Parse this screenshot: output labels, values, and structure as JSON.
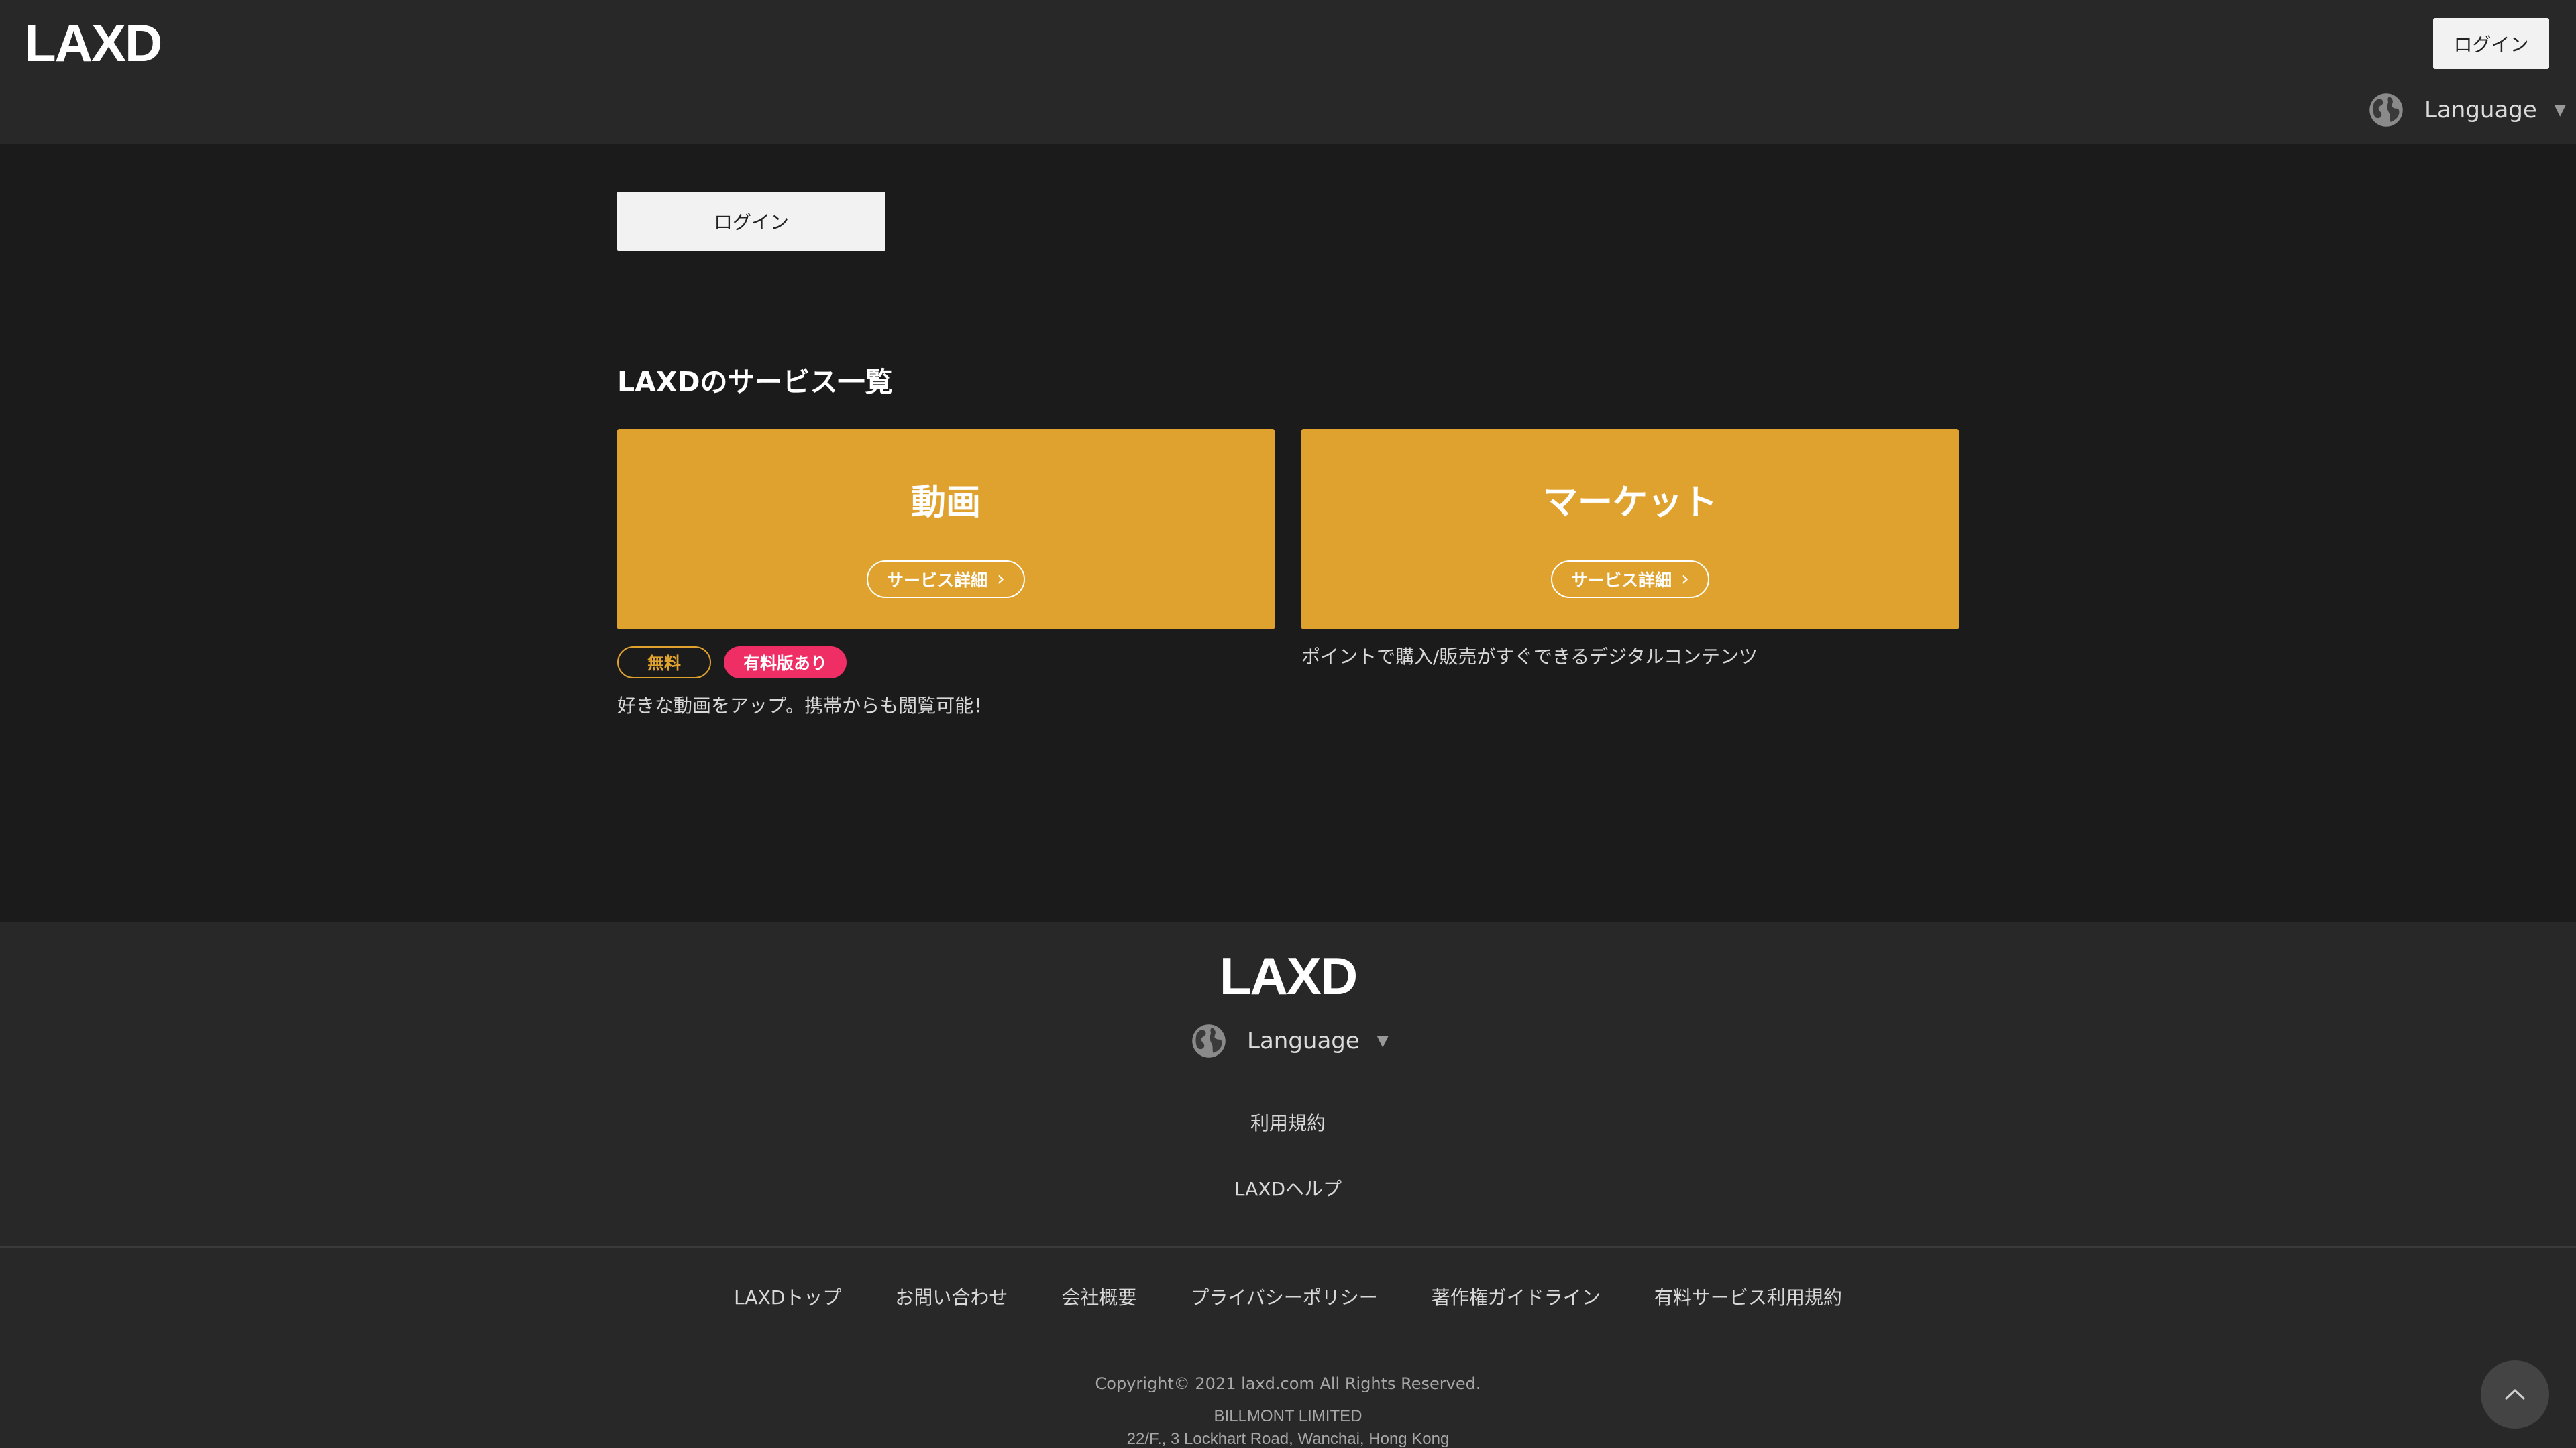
{
  "header": {
    "logo": "LAXD",
    "login_label": "ログイン",
    "language_label": "Language"
  },
  "main": {
    "login_label": "ログイン",
    "section_title": "LAXDのサービス一覧",
    "services": [
      {
        "title": "動画",
        "detail_label": "サービス詳細",
        "tags": [
          "無料",
          "有料版あり"
        ],
        "description": "好きな動画をアップ。携帯からも閲覧可能！"
      },
      {
        "title": "マーケット",
        "detail_label": "サービス詳細",
        "description": "ポイントで購入/販売がすぐできるデジタルコンテンツ"
      }
    ]
  },
  "footer": {
    "logo": "LAXD",
    "language_label": "Language",
    "links": [
      "利用規約",
      "LAXDヘルプ"
    ],
    "nav": [
      "LAXDトップ",
      "お問い合わせ",
      "会社概要",
      "プライバシーポリシー",
      "著作権ガイドライン",
      "有料サービス利用規約"
    ],
    "copyright": "Copyright© 2021 laxd.com All Rights Reserved.",
    "company_name": "BILLMONT LIMITED",
    "company_address": "22/F., 3 Lockhart Road, Wanchai, Hong Kong"
  },
  "colors": {
    "accent": "#e0a22e",
    "paid_badge": "#f02e66",
    "header_bg": "#282828",
    "page_bg": "#1b1b1b"
  },
  "icons": {
    "language": "globe-icon",
    "caret": "caret-down-icon",
    "detail": "chevron-right-icon",
    "back_to_top": "chevron-up-icon"
  }
}
